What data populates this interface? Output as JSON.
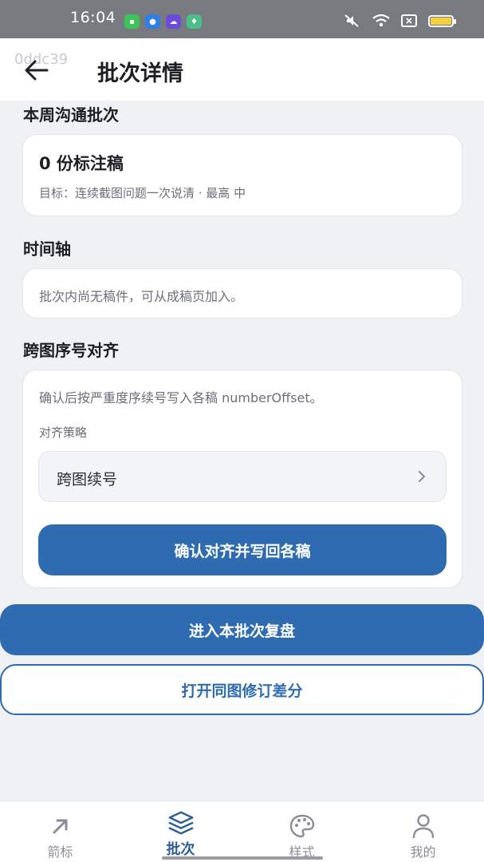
{
  "status_bar": {
    "time": "16:04",
    "apps": [
      {
        "icon": "wechat-icon",
        "color": "#3cc45a"
      },
      {
        "icon": "browser-icon",
        "color": "#2f7fe6"
      },
      {
        "icon": "cloud-icon",
        "color": "#6a4bdc"
      },
      {
        "icon": "pin-icon",
        "color": "#4bbf8a"
      }
    ],
    "icons": [
      "mute-icon",
      "wifi-icon",
      "sim-icon",
      "battery-icon"
    ]
  },
  "header": {
    "watermark": "0ddc39",
    "title": "批次详情",
    "back_icon": "arrow-left-icon"
  },
  "weekly_batch": {
    "section_title": "本周沟通批次",
    "count_text": "0 份标注稿",
    "goal_text": "目标：连续截图问题一次说清 · 最高 中"
  },
  "timeline": {
    "section_title": "时间轴",
    "empty_text": "批次内尚无稿件，可从成稿页加入。"
  },
  "alignment": {
    "section_title": "跨图序号对齐",
    "description": "确认后按严重度序续号写入各稿 numberOffset。",
    "strategy_label": "对齐策略",
    "strategy_value": "跨图续号",
    "confirm_button": "确认对齐并写回各稿"
  },
  "actions": {
    "review_button": "进入本批次复盘",
    "diff_button": "打开同图修订差分"
  },
  "bottom_nav": {
    "items": [
      {
        "label": "箭标",
        "icon": "arrow-up-right-icon",
        "active": false
      },
      {
        "label": "批次",
        "icon": "layers-icon",
        "active": true
      },
      {
        "label": "样式",
        "icon": "palette-icon",
        "active": false
      },
      {
        "label": "我的",
        "icon": "user-icon",
        "active": false
      }
    ]
  },
  "colors": {
    "primary": "#2e6bb0",
    "background": "#f0f1f5",
    "status_bar": "#777b80"
  }
}
